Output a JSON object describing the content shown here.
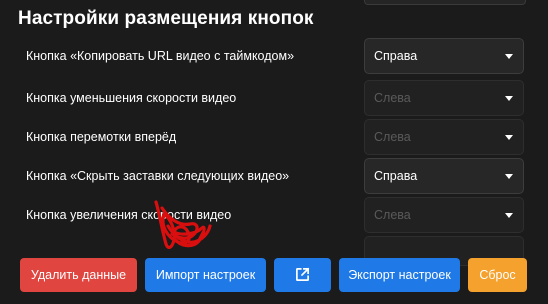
{
  "section": {
    "title": "Настройки размещения кнопок"
  },
  "rows": [
    {
      "label": "Кнопка «Копировать URL видео с таймкодом»",
      "value": "Справа",
      "enabled": true
    },
    {
      "label": "Кнопка уменьшения скорости видео",
      "value": "Слева",
      "enabled": false
    },
    {
      "label": "Кнопка перемотки вперёд",
      "value": "Слева",
      "enabled": false
    },
    {
      "label": "Кнопка «Скрыть заставки следующих видео»",
      "value": "Справа",
      "enabled": true
    },
    {
      "label": "Кнопка увеличения скорости видео",
      "value": "Слева",
      "enabled": false
    }
  ],
  "buttons": {
    "delete_label": "Удалить данные",
    "import_label": "Импорт настроек",
    "open_icon": "external-link-icon",
    "export_label": "Экспорт настроек",
    "reset_label": "Сброс"
  },
  "colors": {
    "background": "#1b1b1b",
    "danger": "#e0453f",
    "primary": "#1f7ae8",
    "warning": "#f4a12d",
    "scribble": "#d90f0f"
  }
}
